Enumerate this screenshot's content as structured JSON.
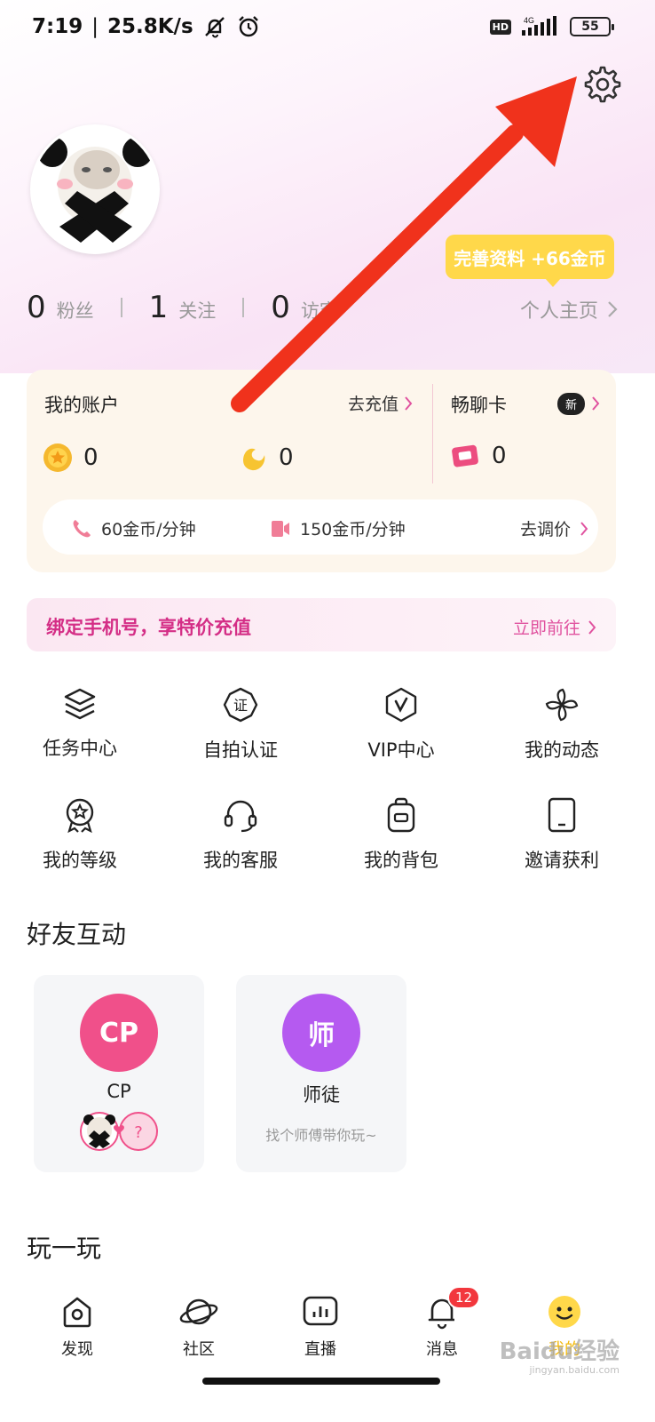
{
  "status_bar": {
    "time": "7:19",
    "net_speed": "25.8K/s",
    "hd": "HD",
    "network": "4G",
    "battery": "55"
  },
  "profile": {
    "complete_tip": "完善资料 +66金币",
    "stats": [
      {
        "value": "0",
        "label": "粉丝"
      },
      {
        "value": "1",
        "label": "关注"
      },
      {
        "value": "0",
        "label": "访客"
      }
    ],
    "homepage": "个人主页"
  },
  "account": {
    "title": "我的账户",
    "recharge": "去充值",
    "coins": "0",
    "points": "0",
    "chat_card_title": "畅聊卡",
    "new_badge": "新",
    "chat_card_count": "0",
    "voice_price": "60金币/分钟",
    "video_price": "150金币/分钟",
    "adjust_price": "去调价"
  },
  "phone_banner": {
    "text": "绑定手机号，享特价充值",
    "action": "立即前往"
  },
  "grid": [
    {
      "label": "任务中心",
      "icon": "layers-icon"
    },
    {
      "label": "自拍认证",
      "icon": "certified-badge-icon"
    },
    {
      "label": "VIP中心",
      "icon": "vip-icon"
    },
    {
      "label": "我的动态",
      "icon": "pinwheel-icon"
    },
    {
      "label": "我的等级",
      "icon": "medal-icon"
    },
    {
      "label": "我的客服",
      "icon": "headset-icon"
    },
    {
      "label": "我的背包",
      "icon": "backpack-icon"
    },
    {
      "label": "邀请获利",
      "icon": "tablet-icon"
    }
  ],
  "friends": {
    "title": "好友互动",
    "cards": [
      {
        "circle": "CP",
        "label": "CP",
        "sub": "",
        "color": "#f0508a"
      },
      {
        "circle": "师",
        "label": "师徒",
        "sub": "找个师傅带你玩~",
        "color": "#b55af0"
      }
    ],
    "cp_question": "?"
  },
  "play": {
    "title": "玩一玩"
  },
  "nav": [
    {
      "label": "发现",
      "icon": "discover-icon"
    },
    {
      "label": "社区",
      "icon": "planet-icon"
    },
    {
      "label": "直播",
      "icon": "live-icon"
    },
    {
      "label": "消息",
      "icon": "bell-icon",
      "badge": "12"
    },
    {
      "label": "我的",
      "icon": "smiley-icon"
    }
  ],
  "watermark": {
    "main": "Baidu经验",
    "sub": "jingyan.baidu.com"
  },
  "colors": {
    "accent_pink": "#d42e86",
    "arrow_red": "#f0321c",
    "coin_gold": "#f5b82e",
    "tooltip_yellow": "#ffd84a"
  }
}
